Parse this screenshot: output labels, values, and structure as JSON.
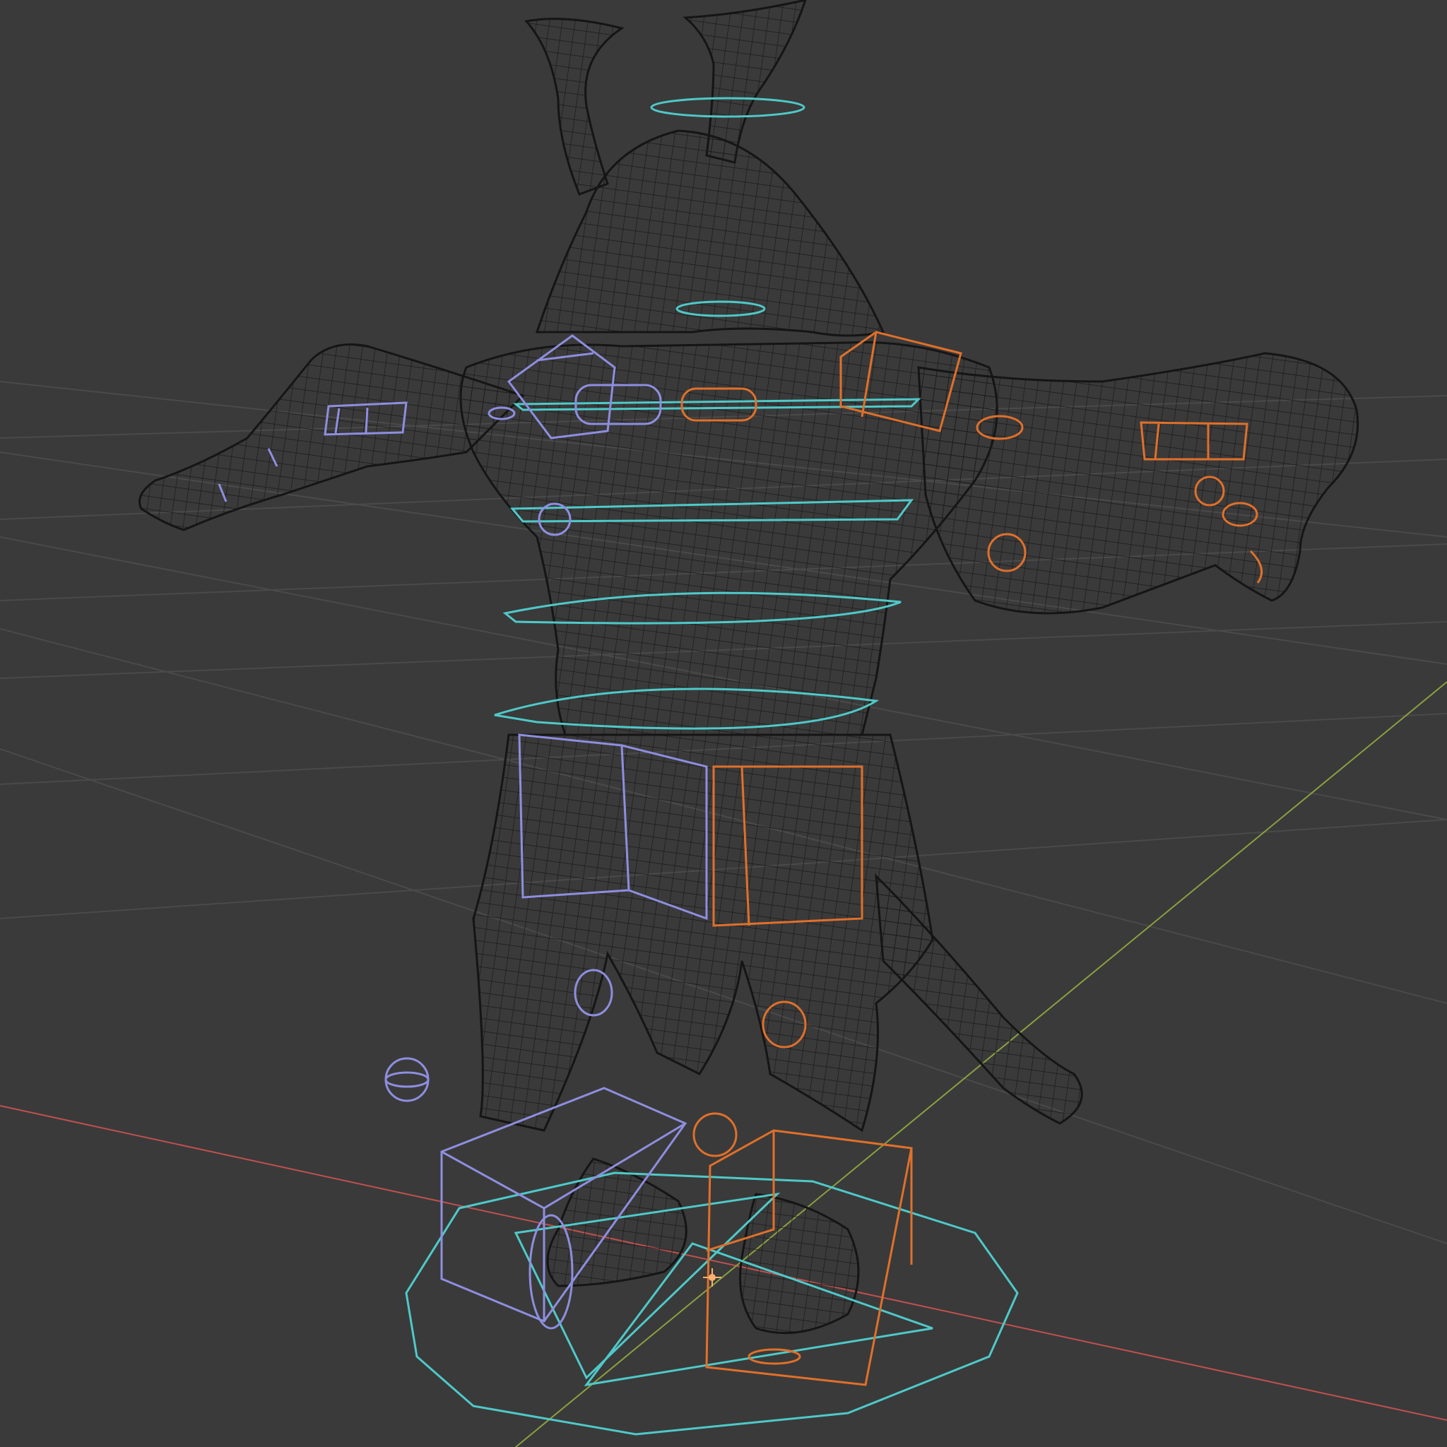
{
  "viewport": {
    "mode": "wireframe",
    "colors": {
      "background": "#3a3a3a",
      "grid": "#4a4a4a",
      "x_axis": "#c05050",
      "y_axis": "#8aa040",
      "mesh": "#1a1a1a",
      "control_cyan": "#4fc9c9",
      "control_left_blue": "#8e8ee0",
      "control_right_orange": "#e0702a",
      "origin": "#ffb070"
    }
  }
}
